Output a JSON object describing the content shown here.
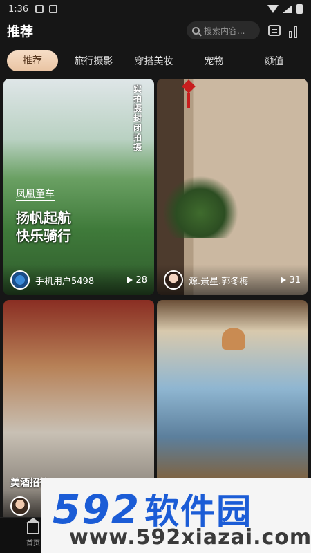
{
  "status_bar": {
    "time": "1:36"
  },
  "header": {
    "title": "推荐",
    "search": {
      "placeholder": "搜索内容..."
    }
  },
  "tabs": [
    "推荐",
    "旅行摄影",
    "穿搭美妆",
    "宠物",
    "颜值"
  ],
  "feed": [
    {
      "overlay_tag": "凤凰童车",
      "overlay_slogan": "扬帆起航\n快乐骑行",
      "vertical_text": "实拍摄 封闭拍摄",
      "author": "手机用户5498",
      "plays": "28"
    },
    {
      "author": "源.景星.郭冬梅",
      "plays": "31"
    },
    {
      "tagline": "美酒招待"
    },
    {}
  ],
  "bottom_nav": {
    "home_label": "首页"
  },
  "watermark": {
    "logo_digits": "592",
    "logo_text": "软件园",
    "url": "www.592xiazai.com"
  }
}
